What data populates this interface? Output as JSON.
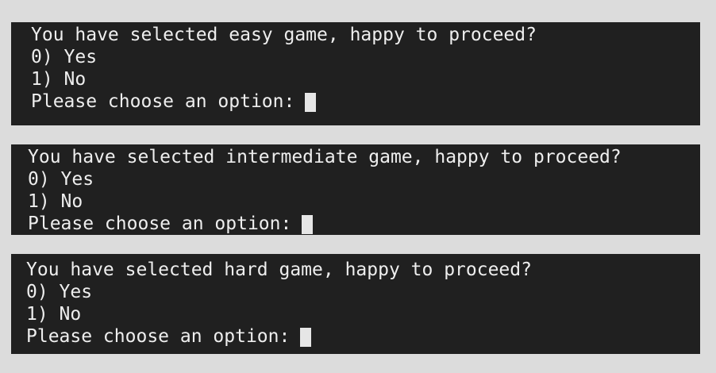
{
  "panels": [
    {
      "question": "You have selected easy game, happy to proceed?",
      "option_yes": "0) Yes",
      "option_no": "1) No",
      "prompt": "Please choose an option:"
    },
    {
      "question": "You have selected intermediate game, happy to proceed?",
      "option_yes": "0) Yes",
      "option_no": "1) No",
      "prompt": "Please choose an option:"
    },
    {
      "question": "You have selected hard game, happy to proceed?",
      "option_yes": "0) Yes",
      "option_no": "1) No",
      "prompt": "Please choose an option:"
    }
  ],
  "colors": {
    "background": "#dcdcdc",
    "terminal": "#202020",
    "text": "#eeeeee",
    "cursor": "#e6e6e6"
  }
}
